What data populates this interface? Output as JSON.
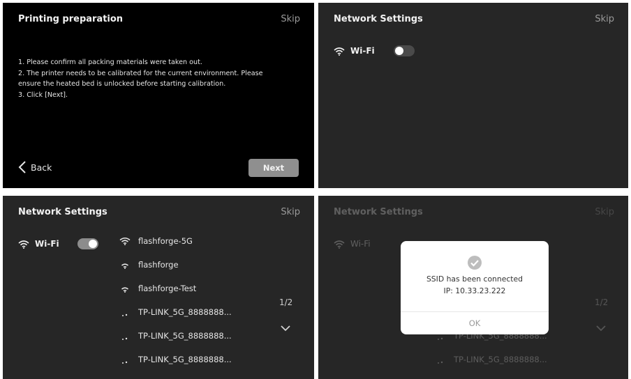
{
  "panel1": {
    "title": "Printing preparation",
    "skip": "Skip",
    "lines": [
      "1. Please confirm all packing materials were taken out.",
      "2. The printer needs to be calibrated for the current environment. Please",
      "ensure the heated bed is unlocked before starting calibration.",
      "3. Click [Next]."
    ],
    "back": "Back",
    "next": "Next"
  },
  "panel2": {
    "title": "Network Settings",
    "skip": "Skip",
    "wifi_label": "Wi-Fi",
    "wifi_on": false
  },
  "panel3": {
    "title": "Network Settings",
    "skip": "Skip",
    "wifi_label": "Wi-Fi",
    "wifi_on": true,
    "networks": [
      {
        "name": "flashforge-5G",
        "icon": "wifi-strong-icon"
      },
      {
        "name": "flashforge",
        "icon": "wifi-medium-icon"
      },
      {
        "name": "flashforge-Test",
        "icon": "wifi-medium-icon"
      },
      {
        "name": "TP-LINK_5G_8888888...",
        "icon": "wifi-weak-icon"
      },
      {
        "name": "TP-LINK_5G_8888888...",
        "icon": "wifi-weak-icon"
      },
      {
        "name": "TP-LINK_5G_8888888...",
        "icon": "wifi-weak-icon"
      }
    ],
    "page": "1/2"
  },
  "panel4": {
    "title": "Network Settings",
    "skip": "Skip",
    "wifi_label": "Wi-Fi",
    "page": "1/2",
    "networks_visible": [
      "TP-LINK_5G_8888888...",
      "TP-LINK_5G_8888888..."
    ],
    "dialog": {
      "line1": "SSID has been connected",
      "line2": "IP: 10.33.23.222",
      "ok": "OK"
    }
  }
}
